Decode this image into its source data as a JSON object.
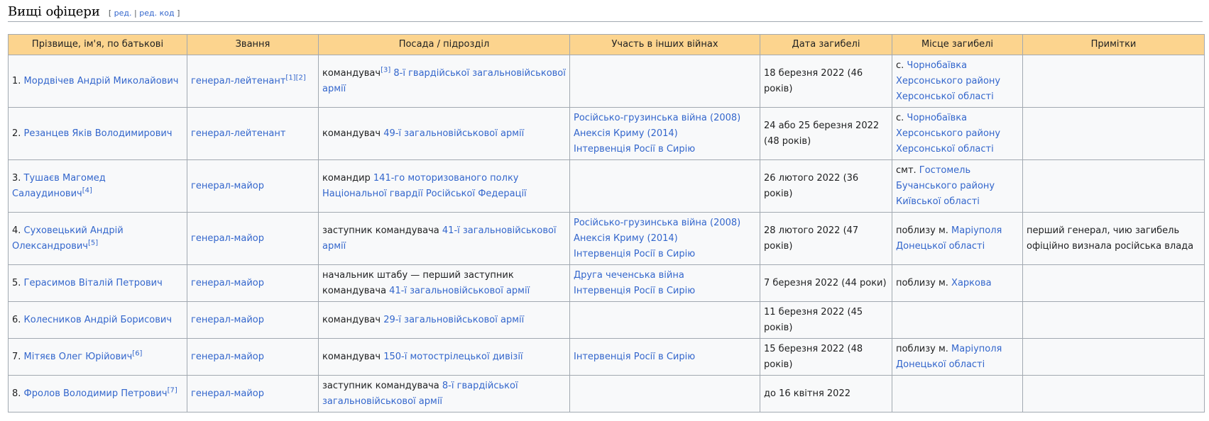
{
  "section": {
    "title": "Вищі офіцери",
    "edit_open": "[",
    "edit_label": "ред.",
    "edit_sep": "|",
    "edit_code_label": "ред. код",
    "edit_close": "]"
  },
  "table": {
    "headers": [
      "Прізвище, ім'я, по батькові",
      "Звання",
      "Посада / підрозділ",
      "Участь в інших війнах",
      "Дата загибелі",
      "Місце загибелі",
      "Примітки"
    ],
    "rows": [
      {
        "num": "1. ",
        "name": "Мордвічев Андрій Миколайович",
        "name_ref": "",
        "rank": "генерал-лейтенант",
        "rank_refs": "[1][2]",
        "post": "командувач",
        "post_ref": "[3]",
        "post_link": "8-ї гвардійської загальновійськової армії",
        "wars": [],
        "death_date": "18 березня 2022 (46 років)",
        "place_pre": "с. ",
        "place_link": "Чорнобаївка Херсонського району Херсонської області",
        "note": ""
      },
      {
        "num": "2. ",
        "name": "Резанцев Яків Володимирович",
        "name_ref": "",
        "rank": "генерал-лейтенант",
        "rank_refs": "",
        "post": "командувач ",
        "post_ref": "",
        "post_link": "49-ї загальновійськової армії",
        "wars": [
          "Російсько-грузинська війна (2008)",
          "Анексія Криму (2014)",
          "Інтервенція Росії в Сирію"
        ],
        "death_date": "24 або 25 березня 2022 (48 років)",
        "place_pre": "с. ",
        "place_link": "Чорнобаївка Херсонського району Херсонської області",
        "note": ""
      },
      {
        "num": "3. ",
        "name": "Тушаєв Магомед Салаудинович",
        "name_ref": "[4]",
        "rank": "генерал-майор",
        "rank_refs": "",
        "post": "командир ",
        "post_ref": "",
        "post_link": "141-го моторизованого полку Національної гвардії Російської Федерації",
        "wars": [],
        "death_date": "26 лютого 2022 (36 років)",
        "place_pre": "смт. ",
        "place_link": "Гостомель Бучанського району Київської області",
        "note": ""
      },
      {
        "num": "4. ",
        "name": "Суховецький Андрій Олександрович",
        "name_ref": "[5]",
        "rank": "генерал-майор",
        "rank_refs": "",
        "post": "заступник командувача ",
        "post_ref": "",
        "post_link": "41-ї загальновійськової армії",
        "wars": [
          "Російсько-грузинська війна (2008)",
          "Анексія Криму (2014)",
          "Інтервенція Росії в Сирію"
        ],
        "death_date": "28 лютого 2022 (47 років)",
        "place_pre": "поблизу м. ",
        "place_link": "Маріуполя Донецької області",
        "note": "перший генерал, чию загибель офіційно визнала російська влада"
      },
      {
        "num": "5. ",
        "name": "Герасимов Віталій Петрович",
        "name_ref": "",
        "rank": "генерал-майор",
        "rank_refs": "",
        "post": "начальник штабу — перший заступник командувача ",
        "post_ref": "",
        "post_link": "41-ї загальновійськової армії",
        "wars": [
          "Друга чеченська війна",
          "Інтервенція Росії в Сирію"
        ],
        "death_date": "7 березня 2022 (44 роки)",
        "place_pre": "поблизу м. ",
        "place_link": "Харкова",
        "note": ""
      },
      {
        "num": "6. ",
        "name": "Колесников Андрій Борисович",
        "name_ref": "",
        "rank": "генерал-майор",
        "rank_refs": "",
        "post": "командувач ",
        "post_ref": "",
        "post_link": "29-ї загальновійськової армії",
        "wars": [],
        "death_date": "11 березня 2022 (45 років)",
        "place_pre": "",
        "place_link": "",
        "note": ""
      },
      {
        "num": "7. ",
        "name": "Мітяєв Олег Юрійович",
        "name_ref": "[6]",
        "rank": "генерал-майор",
        "rank_refs": "",
        "post": "командувач ",
        "post_ref": "",
        "post_link": "150-ї мотострілецької дивізії",
        "wars": [
          "Інтервенція Росії в Сирію"
        ],
        "death_date": "15 березня 2022 (48 років)",
        "place_pre": "поблизу м. ",
        "place_link": "Маріуполя Донецької області",
        "note": ""
      },
      {
        "num": "8. ",
        "name": "Фролов Володимир Петрович",
        "name_ref": "[7]",
        "rank": "генерал-майор",
        "rank_refs": "",
        "post": "заступник командувача ",
        "post_ref": "",
        "post_link": "8-ї гвардійської загальновійськової армії",
        "wars": [],
        "death_date": "до 16 квітня 2022",
        "place_pre": "",
        "place_link": "",
        "note": ""
      }
    ]
  }
}
